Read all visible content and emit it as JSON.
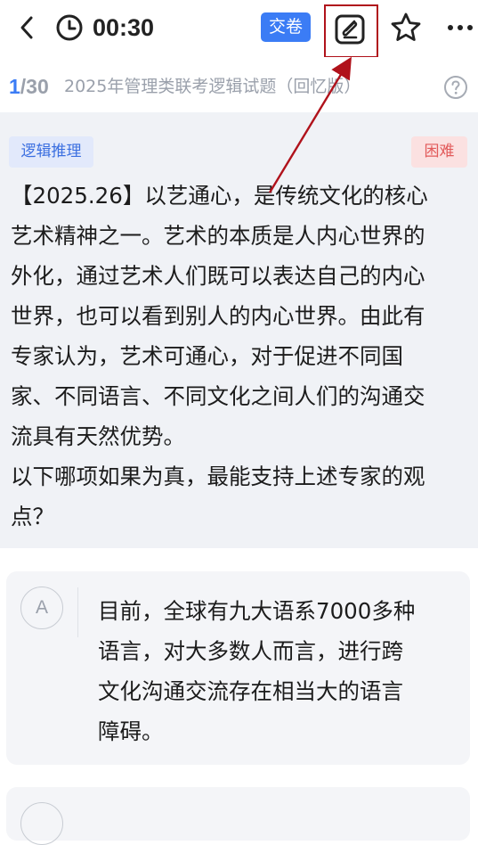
{
  "header": {
    "timer": "00:30",
    "submit_label": "交卷",
    "icons": {
      "back": "chevron-left-icon",
      "clock": "clock-icon",
      "draft": "draft-pen-icon",
      "star": "star-icon",
      "more": "more-dots-icon"
    },
    "colors": {
      "accent": "#3b7cf5",
      "highlight_box": "#b0121b"
    }
  },
  "progress": {
    "current": "1",
    "total": "/30",
    "paper_title": "2025年管理类联考逻辑试题（回忆版）",
    "help_icon": "question-circle-icon"
  },
  "question": {
    "type_tag": "逻辑推理",
    "difficulty_tag": "困难",
    "stem_lines": [
      "【2025.26】以艺通心，是传统文化的核心",
      "艺术精神之一。艺术的本质是人内心世界的",
      "外化，通过艺术人们既可以表达自己的内心",
      "世界，也可以看到别人的内心世界。由此有",
      "专家认为，艺术可通心，对于促进不同国",
      "家、不同语言、不同文化之间人们的沟通交",
      "流具有天然优势。",
      "以下哪项如果为真，最能支持上述专家的观",
      "点？"
    ]
  },
  "options": [
    {
      "letter": "A",
      "lines": [
        "目前，全球有九大语系7000多种",
        "语言，对大多数人而言，进行跨",
        "文化沟通交流存在相当大的语言",
        "障碍。"
      ]
    },
    {
      "letter": "",
      "lines": []
    }
  ]
}
